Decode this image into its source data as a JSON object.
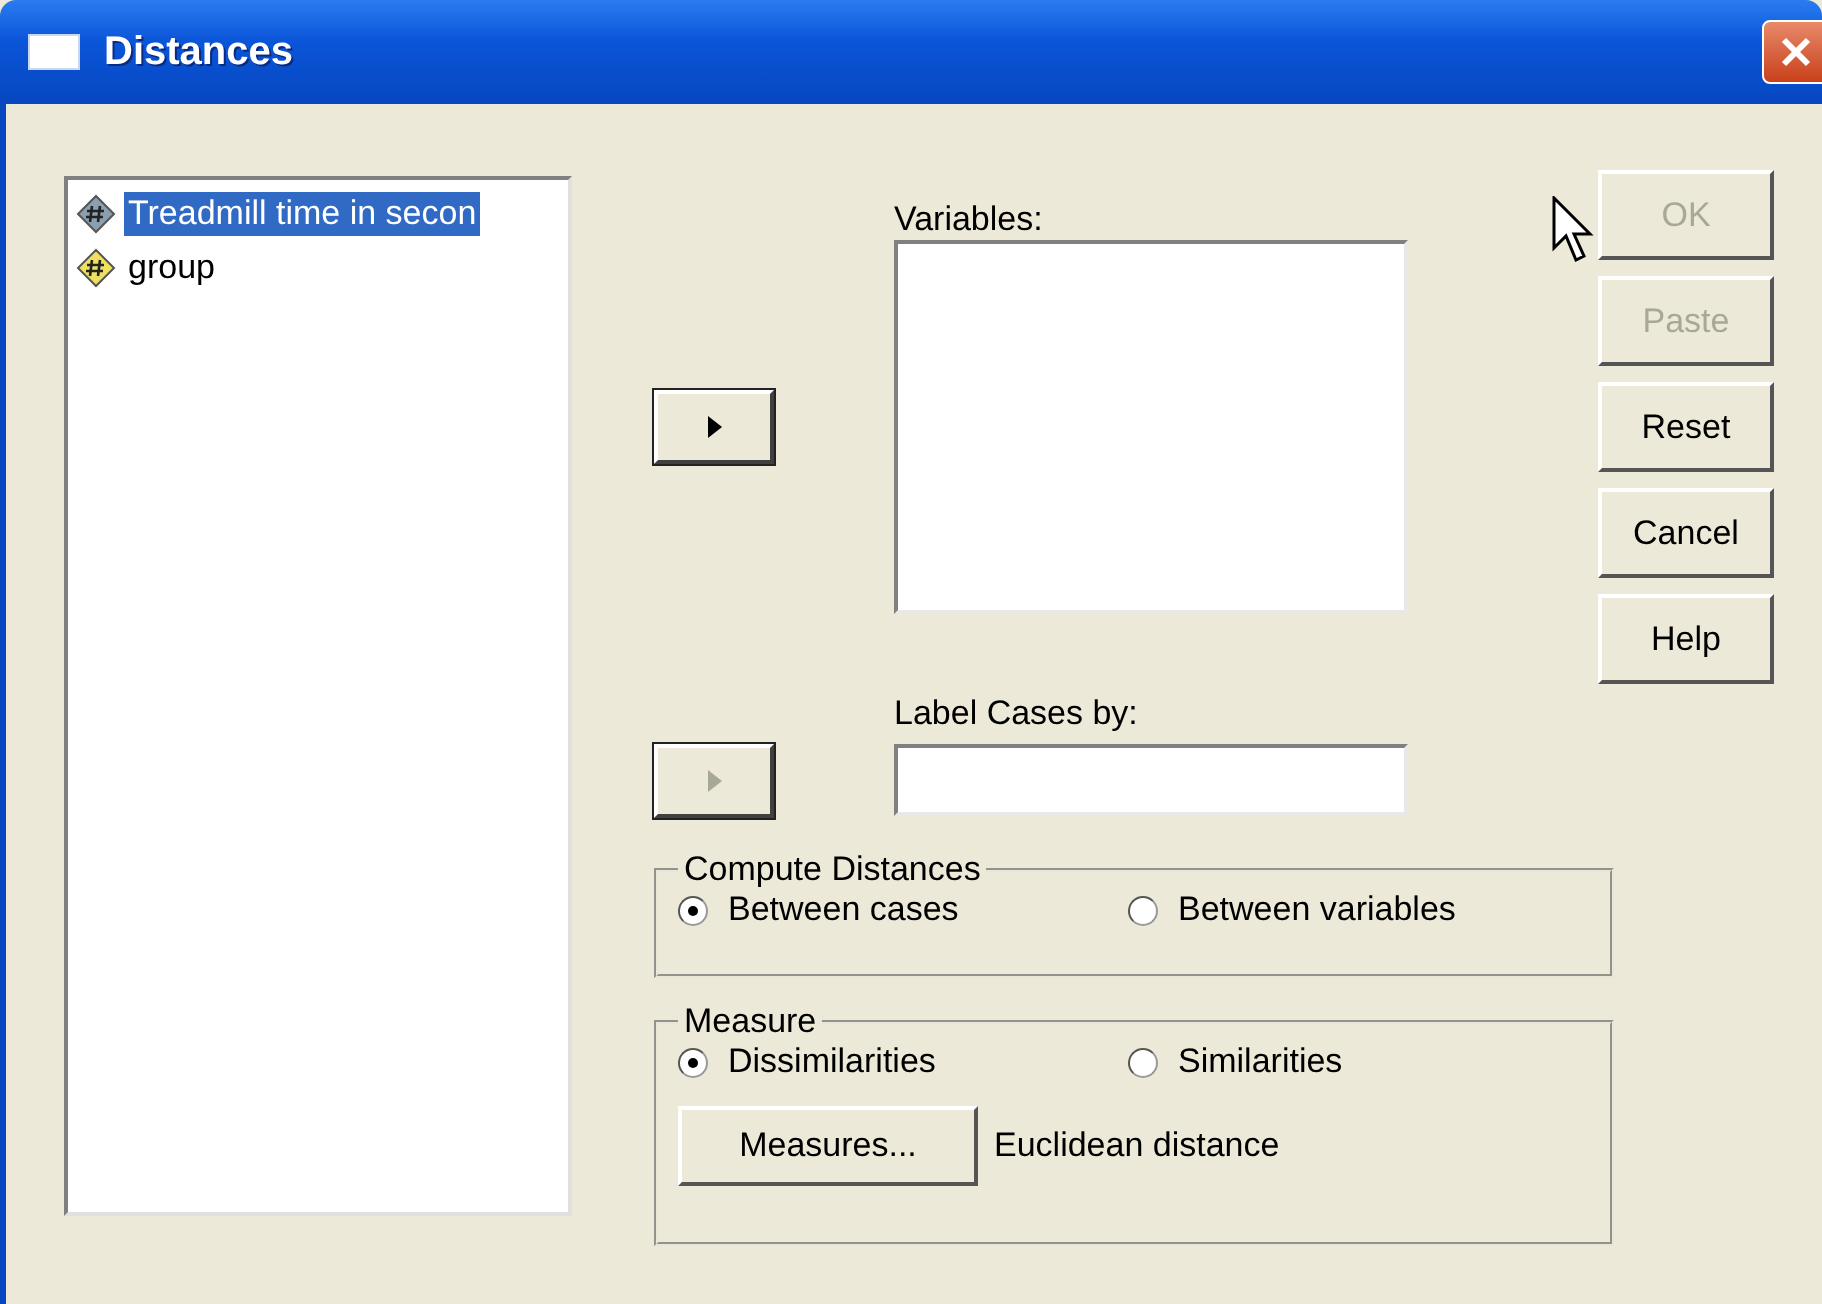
{
  "window": {
    "title": "Distances"
  },
  "source_variables": [
    {
      "label": "Treadmill time in secon",
      "selected": true,
      "color": "#8aa0b0"
    },
    {
      "label": "group",
      "selected": false,
      "color": "#f0e060"
    }
  ],
  "variables": {
    "label": "Variables:",
    "move_button": {
      "disabled": false
    }
  },
  "label_cases": {
    "label": "Label Cases by:",
    "move_button": {
      "disabled": true
    }
  },
  "buttons": [
    {
      "label": "OK",
      "disabled": true
    },
    {
      "label": "Paste",
      "disabled": true
    },
    {
      "label": "Reset",
      "disabled": false
    },
    {
      "label": "Cancel",
      "disabled": false
    },
    {
      "label": "Help",
      "disabled": false
    }
  ],
  "compute_distances": {
    "title": "Compute Distances",
    "options": [
      {
        "label": "Between cases",
        "selected": true
      },
      {
        "label": "Between variables",
        "selected": false
      }
    ]
  },
  "measure": {
    "title": "Measure",
    "options": [
      {
        "label": "Dissimilarities",
        "selected": true
      },
      {
        "label": "Similarities",
        "selected": false
      }
    ],
    "button": "Measures...",
    "value": "Euclidean distance"
  }
}
